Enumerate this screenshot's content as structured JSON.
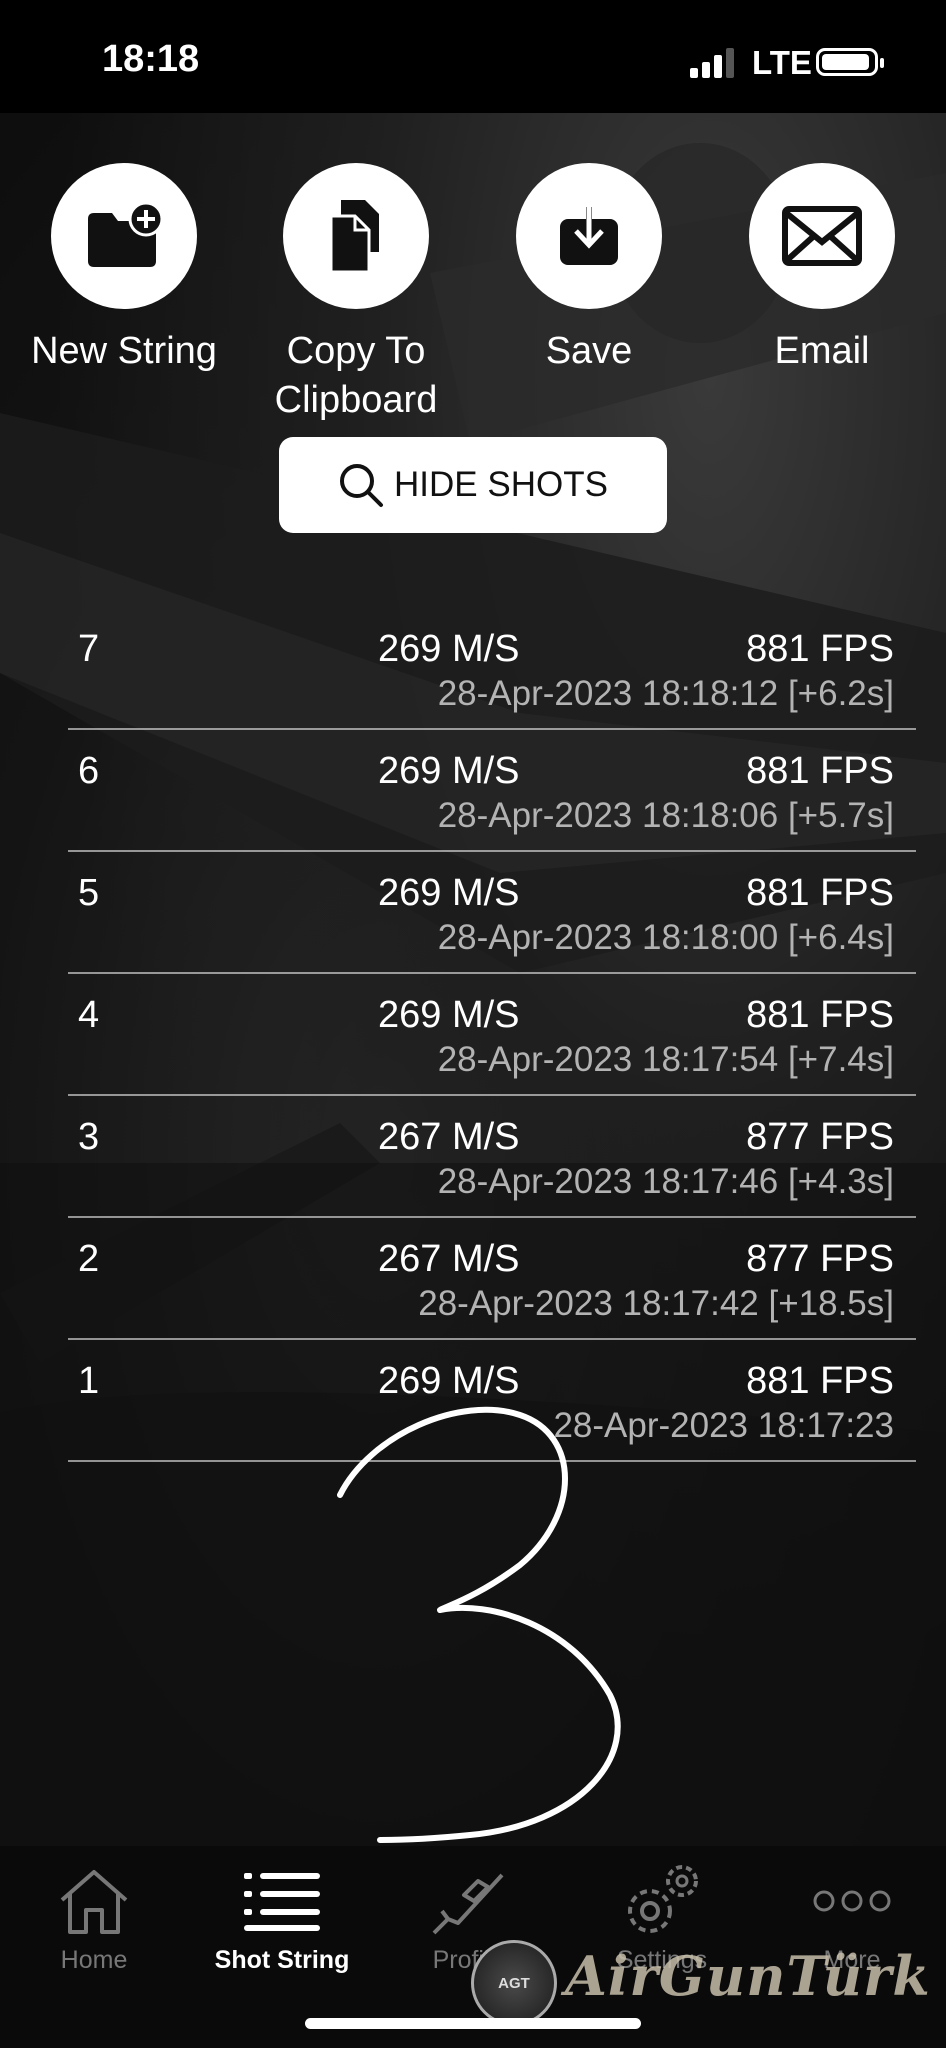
{
  "status_bar": {
    "time": "18:18",
    "network": "LTE"
  },
  "actions": [
    {
      "label": "New String",
      "icon": "folder-plus-icon"
    },
    {
      "label": "Copy To Clipboard",
      "icon": "copy-icon"
    },
    {
      "label": "Save",
      "icon": "download-icon"
    },
    {
      "label": "Email",
      "icon": "envelope-icon"
    }
  ],
  "hide_shots": {
    "label": "HIDE SHOTS",
    "icon": "search-icon"
  },
  "shots": [
    {
      "num": "7",
      "ms": "269 M/S",
      "fps": "881 FPS",
      "timestamp": "28-Apr-2023 18:18:12 [+6.2s]"
    },
    {
      "num": "6",
      "ms": "269 M/S",
      "fps": "881 FPS",
      "timestamp": "28-Apr-2023 18:18:06 [+5.7s]"
    },
    {
      "num": "5",
      "ms": "269 M/S",
      "fps": "881 FPS",
      "timestamp": "28-Apr-2023 18:18:00 [+6.4s]"
    },
    {
      "num": "4",
      "ms": "269 M/S",
      "fps": "881 FPS",
      "timestamp": "28-Apr-2023 18:17:54 [+7.4s]"
    },
    {
      "num": "3",
      "ms": "267 M/S",
      "fps": "877 FPS",
      "timestamp": "28-Apr-2023 18:17:46 [+4.3s]"
    },
    {
      "num": "2",
      "ms": "267 M/S",
      "fps": "877 FPS",
      "timestamp": "28-Apr-2023 18:17:42 [+18.5s]"
    },
    {
      "num": "1",
      "ms": "269 M/S",
      "fps": "881 FPS",
      "timestamp": "28-Apr-2023 18:17:23"
    }
  ],
  "annotation": {
    "text": "3"
  },
  "tabs": [
    {
      "label": "Home",
      "icon": "home-icon",
      "active": false
    },
    {
      "label": "Shot String",
      "icon": "list-icon",
      "active": true
    },
    {
      "label": "Profile",
      "icon": "rifle-icon",
      "active": false
    },
    {
      "label": "Settings",
      "icon": "gear-icon",
      "active": false
    },
    {
      "label": "More",
      "icon": "more-icon",
      "active": false
    }
  ],
  "watermark": {
    "text": "AirGunTürk",
    "badge": "AGT"
  }
}
